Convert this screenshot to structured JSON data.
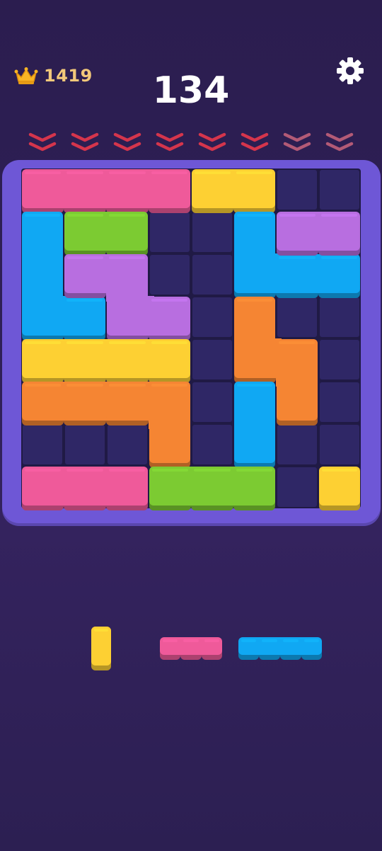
{
  "header": {
    "best_score": "1419",
    "score": "134",
    "crown_icon": "crown-icon",
    "settings_icon": "gear-icon"
  },
  "board": {
    "rows": 8,
    "cols": 8,
    "drop_arrows": 8,
    "pieces": [
      {
        "name": "pink-bar",
        "color": "pink",
        "cells": [
          [
            0,
            0
          ],
          [
            0,
            1
          ],
          [
            0,
            2
          ],
          [
            0,
            3
          ]
        ]
      },
      {
        "name": "yellow-bar",
        "color": "yellow",
        "cells": [
          [
            0,
            4
          ],
          [
            0,
            5
          ]
        ]
      },
      {
        "name": "blue-l-left",
        "color": "blue",
        "cells": [
          [
            1,
            0
          ],
          [
            2,
            0
          ],
          [
            3,
            0
          ],
          [
            3,
            1
          ]
        ]
      },
      {
        "name": "green-bar",
        "color": "green",
        "cells": [
          [
            1,
            1
          ],
          [
            1,
            2
          ]
        ]
      },
      {
        "name": "purple-z",
        "color": "purple",
        "cells": [
          [
            2,
            1
          ],
          [
            2,
            2
          ],
          [
            3,
            2
          ],
          [
            3,
            3
          ]
        ]
      },
      {
        "name": "blue-l-right",
        "color": "blue",
        "cells": [
          [
            1,
            5
          ],
          [
            2,
            5
          ],
          [
            2,
            6
          ],
          [
            2,
            7
          ]
        ]
      },
      {
        "name": "purple-bar",
        "color": "purple",
        "cells": [
          [
            1,
            6
          ],
          [
            1,
            7
          ]
        ]
      },
      {
        "name": "orange-s",
        "color": "orange",
        "cells": [
          [
            3,
            5
          ],
          [
            4,
            5
          ],
          [
            4,
            6
          ],
          [
            5,
            6
          ]
        ]
      },
      {
        "name": "yellow-long-bar",
        "color": "yellow",
        "cells": [
          [
            4,
            0
          ],
          [
            4,
            1
          ],
          [
            4,
            2
          ],
          [
            4,
            3
          ]
        ]
      },
      {
        "name": "orange-l",
        "color": "orange",
        "cells": [
          [
            5,
            0
          ],
          [
            5,
            1
          ],
          [
            5,
            2
          ],
          [
            5,
            3
          ],
          [
            6,
            3
          ]
        ]
      },
      {
        "name": "blue-vertical",
        "color": "blue",
        "cells": [
          [
            5,
            5
          ],
          [
            6,
            5
          ]
        ]
      },
      {
        "name": "pink-bottom-bar",
        "color": "pink",
        "cells": [
          [
            7,
            0
          ],
          [
            7,
            1
          ],
          [
            7,
            2
          ]
        ]
      },
      {
        "name": "green-bottom-bar",
        "color": "green",
        "cells": [
          [
            7,
            3
          ],
          [
            7,
            4
          ],
          [
            7,
            5
          ]
        ]
      },
      {
        "name": "yellow-single",
        "color": "yellow",
        "cells": [
          [
            7,
            7
          ]
        ]
      }
    ]
  },
  "tray": {
    "pieces": [
      {
        "name": "tray-yellow-vertical",
        "color": "yellow",
        "cols": 1,
        "rows": 2
      },
      {
        "name": "tray-pink-bar",
        "color": "pink",
        "cols": 3,
        "rows": 1
      },
      {
        "name": "tray-blue-bar",
        "color": "blue",
        "cols": 4,
        "rows": 1
      }
    ]
  },
  "colors": {
    "pink": "#ef5a9a",
    "yellow": "#fdd033",
    "blue": "#10a8f3",
    "green": "#7ccb32",
    "purple": "#b86ee0",
    "orange": "#f58533",
    "arrow_red": "#d5354c",
    "arrow_faded": "#b35a76"
  }
}
